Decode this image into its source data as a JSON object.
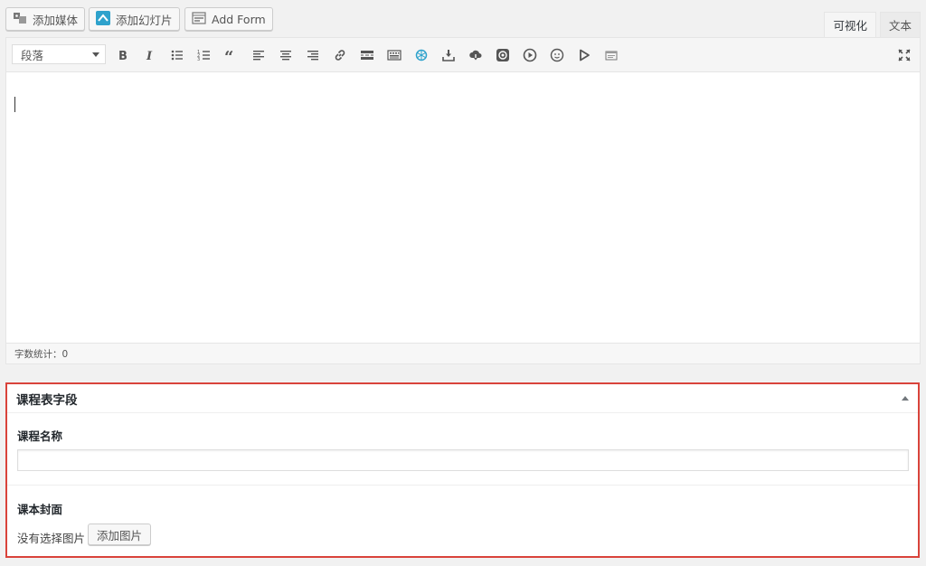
{
  "media_buttons": {
    "add_media": "添加媒体",
    "add_slideshow": "添加幻灯片",
    "add_form": "Add Form"
  },
  "editor_tabs": {
    "visual": "可视化",
    "text": "文本",
    "active": "visual"
  },
  "toolbar": {
    "format_select": "段落",
    "buttons": [
      "bold-icon",
      "italic-icon",
      "bullet-list-icon",
      "numbered-list-icon",
      "blockquote-icon",
      "align-left-icon",
      "align-center-icon",
      "align-right-icon",
      "link-icon",
      "read-more-icon",
      "toolbar-toggle-icon",
      "openai-icon",
      "download-icon",
      "cloud-download-icon",
      "music-icon",
      "play-circle-icon",
      "emoji-icon",
      "play-icon",
      "code-icon",
      "fullscreen-icon"
    ],
    "accent_color": "#2ea2cc"
  },
  "status_bar": {
    "word_count": "字数统计：0"
  },
  "metabox": {
    "title": "课程表字段",
    "border_color": "#d9433b",
    "fields": {
      "course_name_label": "课程名称",
      "course_name_value": "",
      "cover_label": "课本封面",
      "no_image_text": "没有选择图片",
      "add_image_button": "添加图片"
    }
  }
}
